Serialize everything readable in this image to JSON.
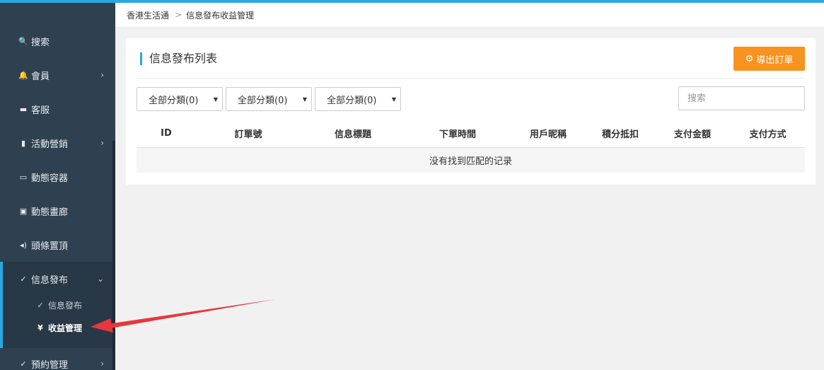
{
  "breadcrumb": {
    "home": "香港生活通",
    "separator": ">",
    "current": "信息發布收益管理"
  },
  "sidebar": {
    "items": [
      {
        "label": "搜索",
        "icon": "search-icon",
        "glyph": "🔍",
        "has_arrow": false
      },
      {
        "label": "會員",
        "icon": "bell-icon",
        "glyph": "🔔",
        "has_arrow": true
      },
      {
        "label": "客服",
        "icon": "comment-icon",
        "glyph": "▬",
        "has_arrow": false
      },
      {
        "label": "活動營銷",
        "icon": "bookmark-icon",
        "glyph": "▮",
        "has_arrow": true
      },
      {
        "label": "動態容器",
        "icon": "inbox-icon",
        "glyph": "▭",
        "has_arrow": false
      },
      {
        "label": "動態畫廊",
        "icon": "picture-icon",
        "glyph": "▣",
        "has_arrow": false
      },
      {
        "label": "頭條置頂",
        "icon": "volume-icon",
        "glyph": "◂)",
        "has_arrow": false
      },
      {
        "label": "信息發布",
        "icon": "check-edit-icon",
        "glyph": "✓",
        "has_arrow": true,
        "expanded": true
      },
      {
        "label": "預約管理",
        "icon": "check-edit-icon",
        "glyph": "✓",
        "has_arrow": true
      }
    ],
    "sub_items": [
      {
        "label": "信息發布",
        "icon": "check-edit-icon",
        "glyph": "✓"
      },
      {
        "label": "收益管理",
        "icon": "yen-icon",
        "glyph": "¥",
        "current": true
      }
    ],
    "arrow_glyph": "›",
    "expanded_glyph": "⌄"
  },
  "panel": {
    "title": "信息發布列表",
    "export_label": "導出訂單",
    "export_icon": "gear-icon"
  },
  "filters": {
    "selects": [
      "全部分類(0)",
      "全部分類(0)",
      "全部分類(0)"
    ],
    "search_placeholder": "搜索"
  },
  "table": {
    "columns": [
      "ID",
      "訂單號",
      "信息標題",
      "下單時間",
      "用戶昵稱",
      "積分抵扣",
      "支付金額",
      "支付方式"
    ],
    "empty_text": "没有找到匹配的记录"
  },
  "colors": {
    "accent": "#29a8e0",
    "sidebar_bg": "#2f4050",
    "export_button": "#f7931e",
    "annotation_arrow": "#e8373a"
  }
}
